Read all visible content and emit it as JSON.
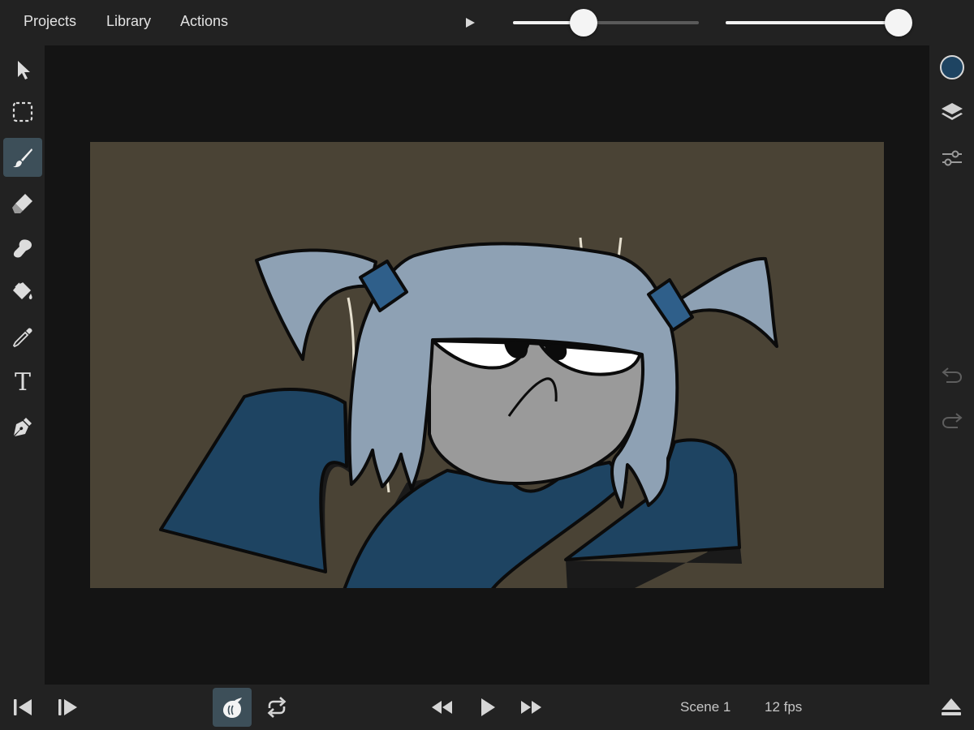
{
  "menu": {
    "projects": "Projects",
    "library": "Library",
    "actions": "Actions"
  },
  "sliders": {
    "brush_size_level": 0.38,
    "opacity_level": 0.93
  },
  "tools": [
    {
      "name": "select",
      "icon": "arrow-pointer-icon",
      "active": false
    },
    {
      "name": "marquee",
      "icon": "dashed-selection-icon",
      "active": false
    },
    {
      "name": "brush",
      "icon": "brush-icon",
      "active": true
    },
    {
      "name": "eraser",
      "icon": "eraser-icon",
      "active": false
    },
    {
      "name": "smudge",
      "icon": "smudge-icon",
      "active": false
    },
    {
      "name": "fill",
      "icon": "paint-bucket-icon",
      "active": false
    },
    {
      "name": "eyedropper",
      "icon": "eyedropper-icon",
      "active": false
    },
    {
      "name": "text",
      "icon": "text-icon",
      "label": "T",
      "active": false
    },
    {
      "name": "pen",
      "icon": "pen-nib-icon",
      "active": false
    }
  ],
  "right_tools": {
    "current_color": "#1e4462",
    "layers_icon": "layers-icon",
    "adjust_icon": "sliders-icon",
    "undo_icon": "undo-icon",
    "redo_icon": "redo-icon"
  },
  "colors": {
    "accent_active": "#3d4f59",
    "canvas_bg": "#4a4335",
    "hair": "#8ea1b4",
    "jacket": "#1e4462",
    "face": "#9a9a9a"
  },
  "timeline": {
    "scene": "Scene 1",
    "fps": "12 fps",
    "onion_skin_active": true
  }
}
